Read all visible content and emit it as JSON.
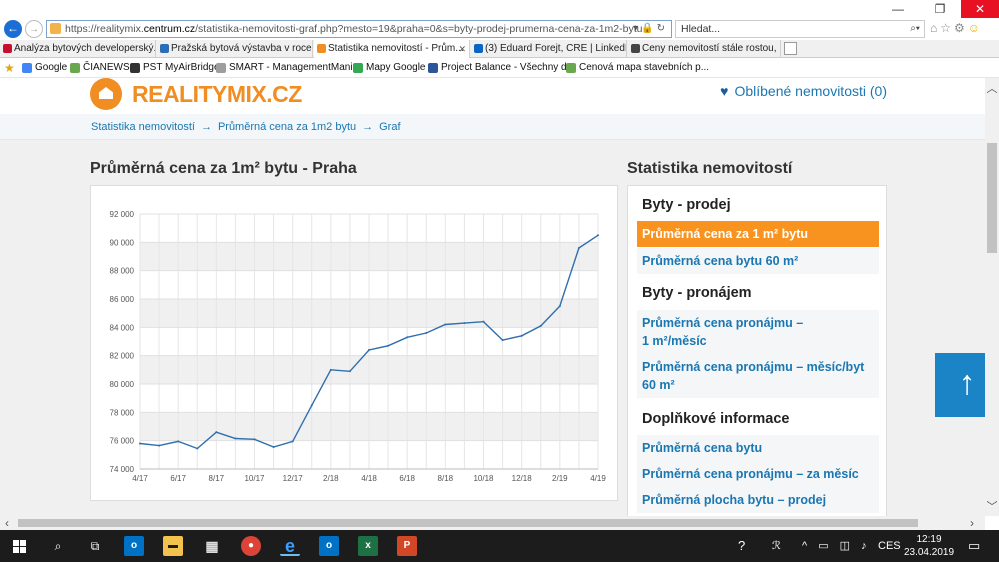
{
  "browser": {
    "url_prefix": "https://realitymix.",
    "url_host": "centrum.cz",
    "url_path": "/statistika-nemovitosti-graf.php?mesto=19&praha=0&s=byty-prodej-prumerna-cena-za-1m2-bytu",
    "search_placeholder": "Hledat...",
    "tabs": [
      {
        "label": "Analýza bytových developerský...",
        "color": "#c8102e"
      },
      {
        "label": "Pražská bytová výstavba v roce ...",
        "color": "#2d6db5"
      },
      {
        "label": "Statistika nemovitostí - Prům...",
        "color": "#f08d23"
      },
      {
        "label": "(3) Eduard Forejt, CRE | LinkedIn",
        "color": "#0a66c2"
      },
      {
        "label": "Ceny nemovitostí stále rostou, ...",
        "color": "#444444"
      }
    ],
    "favorites": [
      {
        "label": "Google",
        "color": "#4285f4"
      },
      {
        "label": "ČIANEWS",
        "color": "#6aa84f"
      },
      {
        "label": "PST MyAirBridge",
        "color": "#333333"
      },
      {
        "label": "SMART - ManagementMania",
        "color": "#9e9e9e"
      },
      {
        "label": "Mapy Google",
        "color": "#34a853"
      },
      {
        "label": "Project Balance - Všechny d...",
        "color": "#2b579a"
      },
      {
        "label": "Cenová mapa stavebních p...",
        "color": "#6aa84f"
      }
    ]
  },
  "site": {
    "logo": "REALITYMIX.CZ",
    "favorites_link": "Oblíbené nemovitosti (0)",
    "breadcrumb": [
      "Statistika nemovitostí",
      "Průměrná cena za 1m2 bytu",
      "Graf"
    ],
    "chart_title": "Průměrná cena za 1m² bytu - Praha",
    "sidebar_title": "Statistika nemovitostí",
    "sidebar": {
      "group1": "Byty - prodej",
      "link1": "Průměrná cena za 1 m² bytu",
      "link2": "Průměrná cena bytu 60 m²",
      "group2": "Byty - pronájem",
      "link3a": "Průměrná cena pronájmu –",
      "link3b": "1 m²/měsíc",
      "link4a": "Průměrná cena pronájmu – měsíc/byt",
      "link4b": "60 m²",
      "group3": "Doplňkové informace",
      "link5": "Průměrná cena bytu",
      "link6": "Průměrná cena pronájmu – za měsíc",
      "link7": "Průměrná plocha bytu – prodej"
    },
    "scroll_up": "↑"
  },
  "chart_data": {
    "type": "line",
    "title": "",
    "xlabel": "",
    "ylabel": "",
    "ylim": [
      74000,
      92000
    ],
    "yticks": [
      "92 000",
      "90 000",
      "88 000",
      "86 000",
      "84 000",
      "82 000",
      "80 000",
      "78 000",
      "76 000",
      "74 000"
    ],
    "ytick_values": [
      92000,
      90000,
      88000,
      86000,
      84000,
      82000,
      80000,
      78000,
      76000,
      74000
    ],
    "xticks": [
      "4/17",
      "6/17",
      "8/17",
      "10/17",
      "12/17",
      "2/18",
      "4/18",
      "6/18",
      "8/18",
      "10/18",
      "12/18",
      "2/19",
      "4/19"
    ],
    "x": [
      "4/17",
      "5/17",
      "6/17",
      "7/17",
      "8/17",
      "9/17",
      "10/17",
      "11/17",
      "12/17",
      "1/18",
      "2/18",
      "3/18",
      "4/18",
      "5/18",
      "6/18",
      "7/18",
      "8/18",
      "9/18",
      "10/18",
      "11/18",
      "12/18",
      "1/19",
      "2/19",
      "3/19",
      "4/19"
    ],
    "values": [
      75800,
      75650,
      75950,
      75450,
      76600,
      76150,
      76100,
      75550,
      75950,
      78500,
      81000,
      80900,
      82400,
      82700,
      83300,
      83600,
      84200,
      84300,
      84400,
      83100,
      83400,
      84100,
      85500,
      89600,
      90500
    ],
    "grid": true,
    "line_color": "#2f6fae"
  },
  "taskbar": {
    "time": "12:19",
    "date": "23.04.2019",
    "lang": "CES"
  }
}
